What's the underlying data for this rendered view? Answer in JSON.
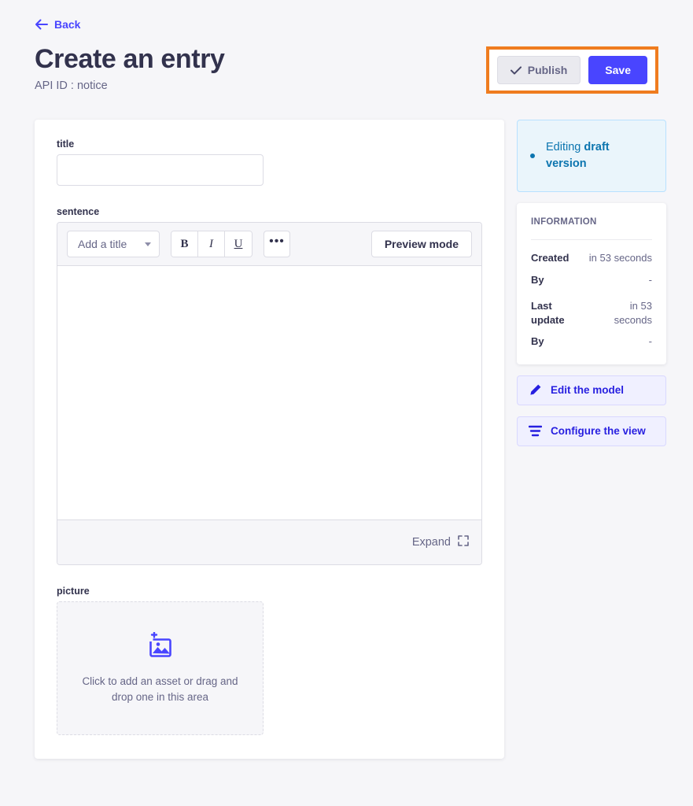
{
  "header": {
    "back_label": "Back",
    "back_icon": "arrow-left-icon",
    "title": "Create an entry",
    "api_id": "API ID : notice"
  },
  "actions": {
    "highlight_color": "#ef7c1f",
    "publish_label": "Publish",
    "publish_icon": "check-icon",
    "save_label": "Save",
    "save_color": "#4945ff"
  },
  "form": {
    "title_field": {
      "label": "title",
      "value": "",
      "placeholder": ""
    },
    "sentence_field": {
      "label": "sentence",
      "toolbar": {
        "title_select_label": "Add a title",
        "title_select_icon": "chevron-down-icon",
        "bold_label": "B",
        "italic_label": "I",
        "underline_label": "U",
        "more_label": "•••",
        "preview_label": "Preview mode"
      },
      "content": "",
      "expand_label": "Expand",
      "expand_icon": "expand-icon"
    },
    "picture_field": {
      "label": "picture",
      "dropzone_icon": "add-image-icon",
      "dropzone_text": "Click to add an asset or drag and drop one in this area"
    }
  },
  "sidebar": {
    "status": {
      "prefix": "Editing ",
      "emphasis": "draft version",
      "accent_color": "#0c75af",
      "background": "#eaf5fb"
    },
    "information": {
      "title": "INFORMATION",
      "groups": [
        {
          "rows": [
            {
              "key": "Created",
              "value": "in 53 seconds"
            },
            {
              "key": "By",
              "value": "-"
            }
          ]
        },
        {
          "rows": [
            {
              "key": "Last update",
              "value": "in 53 seconds"
            },
            {
              "key": "By",
              "value": "-"
            }
          ]
        }
      ]
    },
    "buttons": [
      {
        "label": "Edit the model",
        "icon": "pencil-icon"
      },
      {
        "label": "Configure the view",
        "icon": "layout-lines-icon"
      }
    ]
  }
}
